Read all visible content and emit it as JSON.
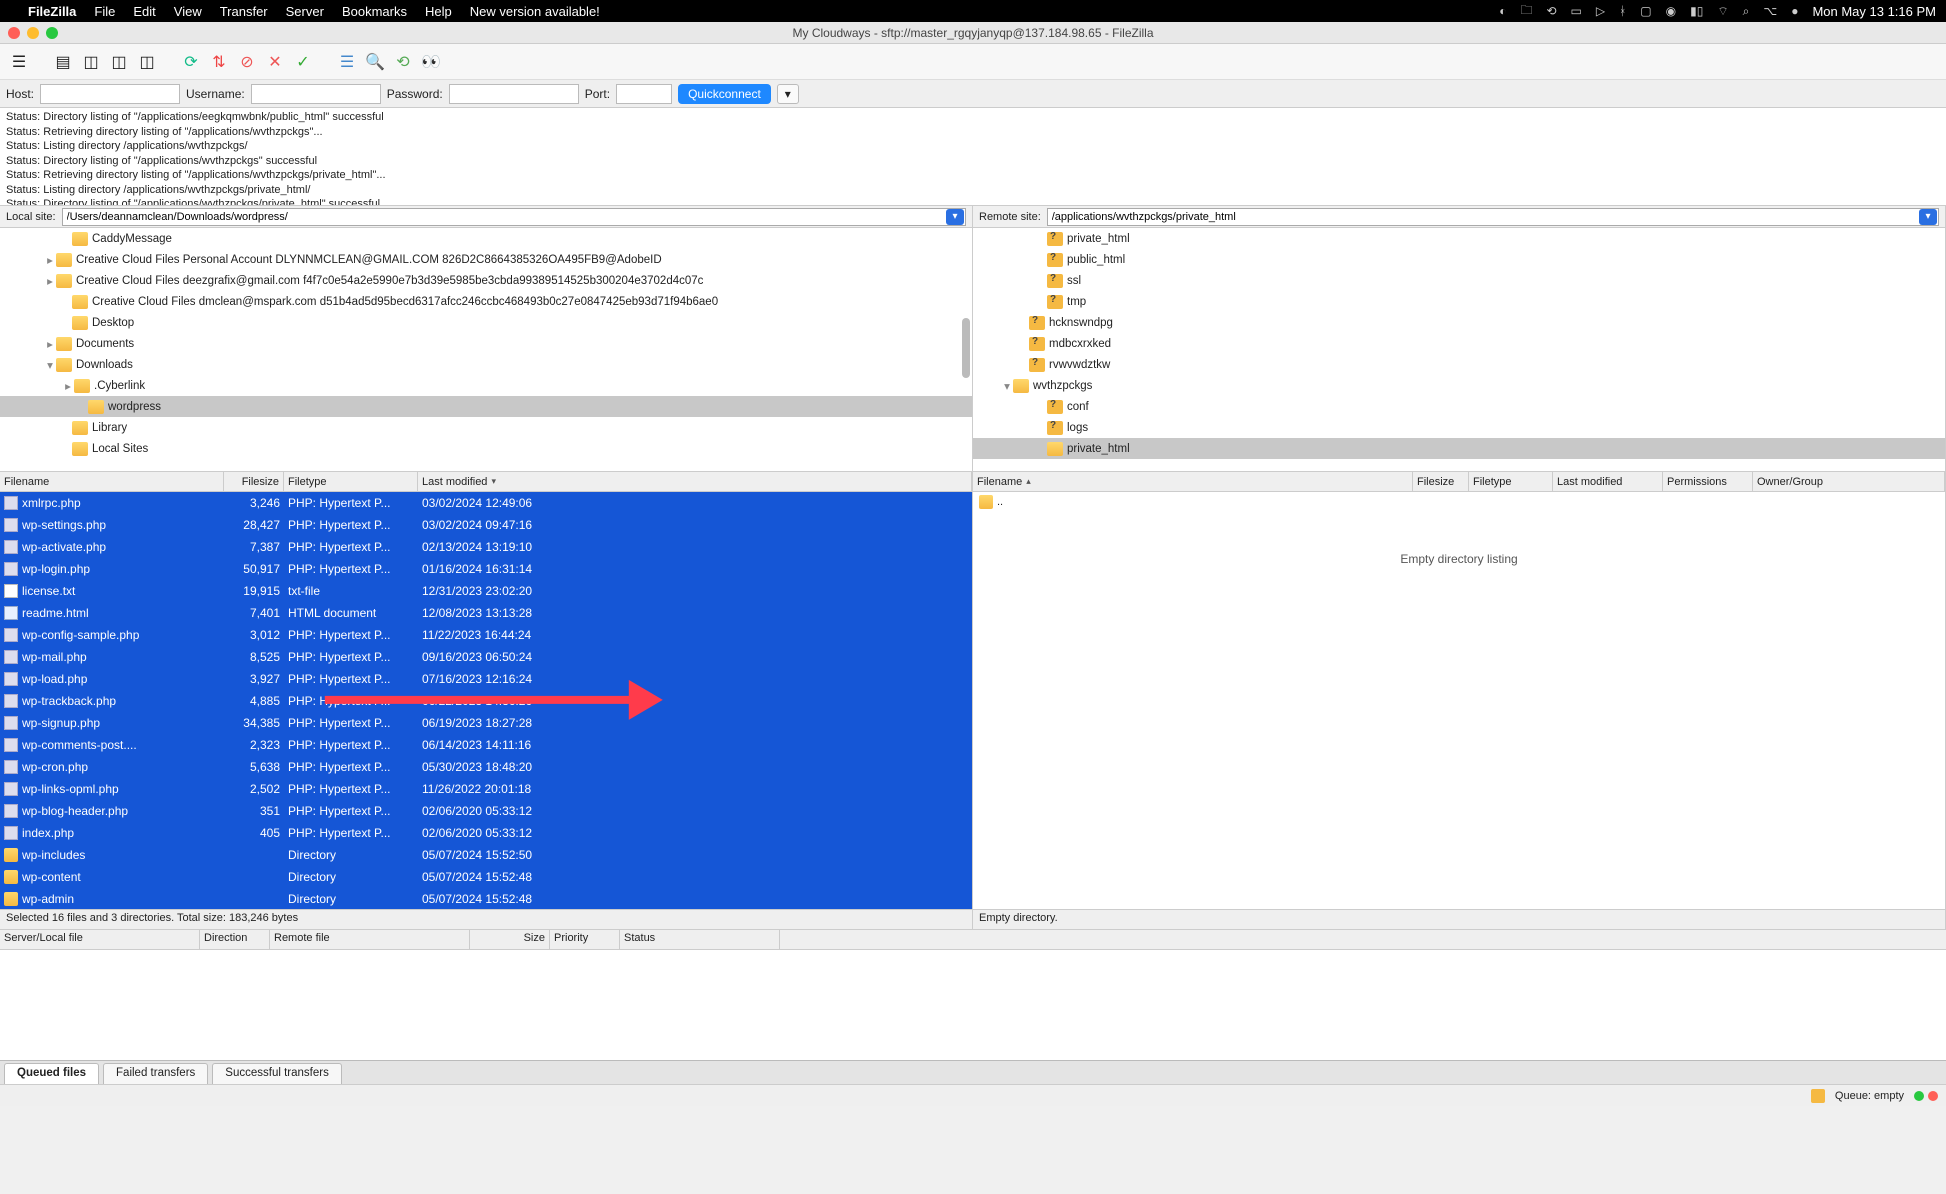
{
  "menubar": {
    "app": "FileZilla",
    "items": [
      "File",
      "Edit",
      "View",
      "Transfer",
      "Server",
      "Bookmarks",
      "Help",
      "New version available!"
    ],
    "clock": "Mon May 13  1:16 PM"
  },
  "window": {
    "title": "My Cloudways - sftp://master_rgqyjanyqp@137.184.98.65 - FileZilla"
  },
  "quickconnect": {
    "host_label": "Host:",
    "user_label": "Username:",
    "pass_label": "Password:",
    "port_label": "Port:",
    "host": "",
    "user": "",
    "pass": "",
    "port": "",
    "btn": "Quickconnect"
  },
  "log": [
    "Status:      Directory listing of \"/applications/eegkqmwbnk/public_html\" successful",
    "Status:      Retrieving directory listing of \"/applications/wvthzpckgs\"...",
    "Status:      Listing directory /applications/wvthzpckgs/",
    "Status:      Directory listing of \"/applications/wvthzpckgs\" successful",
    "Status:      Retrieving directory listing of \"/applications/wvthzpckgs/private_html\"...",
    "Status:      Listing directory /applications/wvthzpckgs/private_html/",
    "Status:      Directory listing of \"/applications/wvthzpckgs/private_html\" successful"
  ],
  "paths": {
    "local_label": "Local site:",
    "local_val": "/Users/deannamclean/Downloads/wordpress/",
    "remote_label": "Remote site:",
    "remote_val": "/applications/wvthzpckgs/private_html"
  },
  "local_tree": [
    {
      "indent": 60,
      "twist": "",
      "icon": "fld",
      "label": "CaddyMessage"
    },
    {
      "indent": 44,
      "twist": "▸",
      "icon": "fld",
      "label": "Creative Cloud Files Personal Account DLYNNMCLEAN@GMAIL.COM 826D2C8664385326OA495FB9@AdobeID"
    },
    {
      "indent": 44,
      "twist": "▸",
      "icon": "fld",
      "label": "Creative Cloud Files deezgrafix@gmail.com f4f7c0e54a2e5990e7b3d39e5985be3cbda99389514525b300204e3702d4c07c"
    },
    {
      "indent": 60,
      "twist": "",
      "icon": "fld",
      "label": "Creative Cloud Files dmclean@mspark.com d51b4ad5d95becd6317afcc246ccbc468493b0c27e0847425eb93d71f94b6ae0"
    },
    {
      "indent": 60,
      "twist": "",
      "icon": "fld",
      "label": "Desktop"
    },
    {
      "indent": 44,
      "twist": "▸",
      "icon": "fld",
      "label": "Documents"
    },
    {
      "indent": 44,
      "twist": "▾",
      "icon": "fld",
      "label": "Downloads"
    },
    {
      "indent": 62,
      "twist": "▸",
      "icon": "fld",
      "label": ".Cyberlink"
    },
    {
      "indent": 76,
      "twist": "",
      "icon": "fld",
      "label": "wordpress",
      "sel": true
    },
    {
      "indent": 60,
      "twist": "",
      "icon": "fld",
      "label": "Library"
    },
    {
      "indent": 60,
      "twist": "",
      "icon": "fld",
      "label": "Local Sites"
    }
  ],
  "remote_tree": [
    {
      "indent": 62,
      "twist": "",
      "icon": "fldq",
      "label": "private_html"
    },
    {
      "indent": 62,
      "twist": "",
      "icon": "fldq",
      "label": "public_html"
    },
    {
      "indent": 62,
      "twist": "",
      "icon": "fldq",
      "label": "ssl"
    },
    {
      "indent": 62,
      "twist": "",
      "icon": "fldq",
      "label": "tmp"
    },
    {
      "indent": 44,
      "twist": "",
      "icon": "fldq",
      "label": "hcknswndpg"
    },
    {
      "indent": 44,
      "twist": "",
      "icon": "fldq",
      "label": "mdbcxrxked"
    },
    {
      "indent": 44,
      "twist": "",
      "icon": "fldq",
      "label": "rvwvwdztkw"
    },
    {
      "indent": 28,
      "twist": "▾",
      "icon": "fld",
      "label": "wvthzpckgs"
    },
    {
      "indent": 62,
      "twist": "",
      "icon": "fldq",
      "label": "conf"
    },
    {
      "indent": 62,
      "twist": "",
      "icon": "fldq",
      "label": "logs"
    },
    {
      "indent": 62,
      "twist": "",
      "icon": "fld",
      "label": "private_html",
      "sel": true
    }
  ],
  "local_cols": {
    "name": "Filename",
    "size": "Filesize",
    "type": "Filetype",
    "mod": "Last modified"
  },
  "remote_cols": {
    "name": "Filename",
    "size": "Filesize",
    "type": "Filetype",
    "mod": "Last modified",
    "perm": "Permissions",
    "owner": "Owner/Group"
  },
  "local_files": [
    {
      "ic": "php",
      "n": "xmlrpc.php",
      "s": "3,246",
      "t": "PHP: Hypertext P...",
      "m": "03/02/2024 12:49:06"
    },
    {
      "ic": "php",
      "n": "wp-settings.php",
      "s": "28,427",
      "t": "PHP: Hypertext P...",
      "m": "03/02/2024 09:47:16"
    },
    {
      "ic": "php",
      "n": "wp-activate.php",
      "s": "7,387",
      "t": "PHP: Hypertext P...",
      "m": "02/13/2024 13:19:10"
    },
    {
      "ic": "php",
      "n": "wp-login.php",
      "s": "50,917",
      "t": "PHP: Hypertext P...",
      "m": "01/16/2024 16:31:14"
    },
    {
      "ic": "txt",
      "n": "license.txt",
      "s": "19,915",
      "t": "txt-file",
      "m": "12/31/2023 23:02:20"
    },
    {
      "ic": "htm",
      "n": "readme.html",
      "s": "7,401",
      "t": "HTML document",
      "m": "12/08/2023 13:13:28"
    },
    {
      "ic": "php",
      "n": "wp-config-sample.php",
      "s": "3,012",
      "t": "PHP: Hypertext P...",
      "m": "11/22/2023 16:44:24"
    },
    {
      "ic": "php",
      "n": "wp-mail.php",
      "s": "8,525",
      "t": "PHP: Hypertext P...",
      "m": "09/16/2023 06:50:24"
    },
    {
      "ic": "php",
      "n": "wp-load.php",
      "s": "3,927",
      "t": "PHP: Hypertext P...",
      "m": "07/16/2023 12:16:24"
    },
    {
      "ic": "php",
      "n": "wp-trackback.php",
      "s": "4,885",
      "t": "PHP: Hypertext P...",
      "m": "06/22/2023 14:36:26"
    },
    {
      "ic": "php",
      "n": "wp-signup.php",
      "s": "34,385",
      "t": "PHP: Hypertext P...",
      "m": "06/19/2023 18:27:28"
    },
    {
      "ic": "php",
      "n": "wp-comments-post....",
      "s": "2,323",
      "t": "PHP: Hypertext P...",
      "m": "06/14/2023 14:11:16"
    },
    {
      "ic": "php",
      "n": "wp-cron.php",
      "s": "5,638",
      "t": "PHP: Hypertext P...",
      "m": "05/30/2023 18:48:20"
    },
    {
      "ic": "php",
      "n": "wp-links-opml.php",
      "s": "2,502",
      "t": "PHP: Hypertext P...",
      "m": "11/26/2022 20:01:18"
    },
    {
      "ic": "php",
      "n": "wp-blog-header.php",
      "s": "351",
      "t": "PHP: Hypertext P...",
      "m": "02/06/2020 05:33:12"
    },
    {
      "ic": "php",
      "n": "index.php",
      "s": "405",
      "t": "PHP: Hypertext P...",
      "m": "02/06/2020 05:33:12"
    },
    {
      "ic": "dir",
      "n": "wp-includes",
      "s": "",
      "t": "Directory",
      "m": "05/07/2024 15:52:50"
    },
    {
      "ic": "dir",
      "n": "wp-content",
      "s": "",
      "t": "Directory",
      "m": "05/07/2024 15:52:48"
    },
    {
      "ic": "dir",
      "n": "wp-admin",
      "s": "",
      "t": "Directory",
      "m": "05/07/2024 15:52:48"
    }
  ],
  "remote_entry_up": "..",
  "remote_empty": "Empty directory listing",
  "local_status": "Selected 16 files and 3 directories. Total size: 183,246 bytes",
  "remote_status": "Empty directory.",
  "queue_cols": [
    "Server/Local file",
    "Direction",
    "Remote file",
    "Size",
    "Priority",
    "Status"
  ],
  "tabs": [
    "Queued files",
    "Failed transfers",
    "Successful transfers"
  ],
  "footer": {
    "queue": "Queue: empty"
  }
}
